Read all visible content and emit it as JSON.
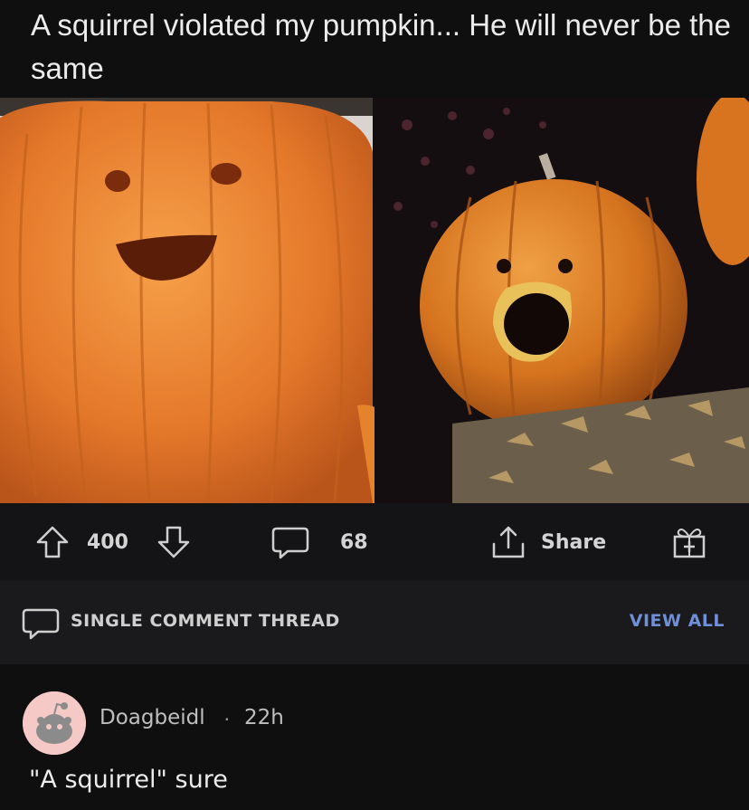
{
  "post": {
    "title": "A squirrel violated my pumpkin... He will never be the same"
  },
  "actions": {
    "score": "400",
    "comments": "68",
    "share_label": "Share"
  },
  "thread": {
    "label": "SINGLE COMMENT THREAD",
    "view_all": "VIEW ALL"
  },
  "comment": {
    "username": "Doagbeidl",
    "separator": "·",
    "time": "22h",
    "body": "\"A squirrel\" sure"
  },
  "icons": [
    "upvote-arrow-icon",
    "downvote-arrow-icon",
    "comment-bubble-icon",
    "share-icon",
    "award-gift-icon",
    "speech-bubble-icon",
    "reddit-avatar-icon"
  ],
  "colors": {
    "background": "#0f0f10",
    "view_all": "#6f8fd8",
    "pumpkin": "#e07a1f"
  }
}
